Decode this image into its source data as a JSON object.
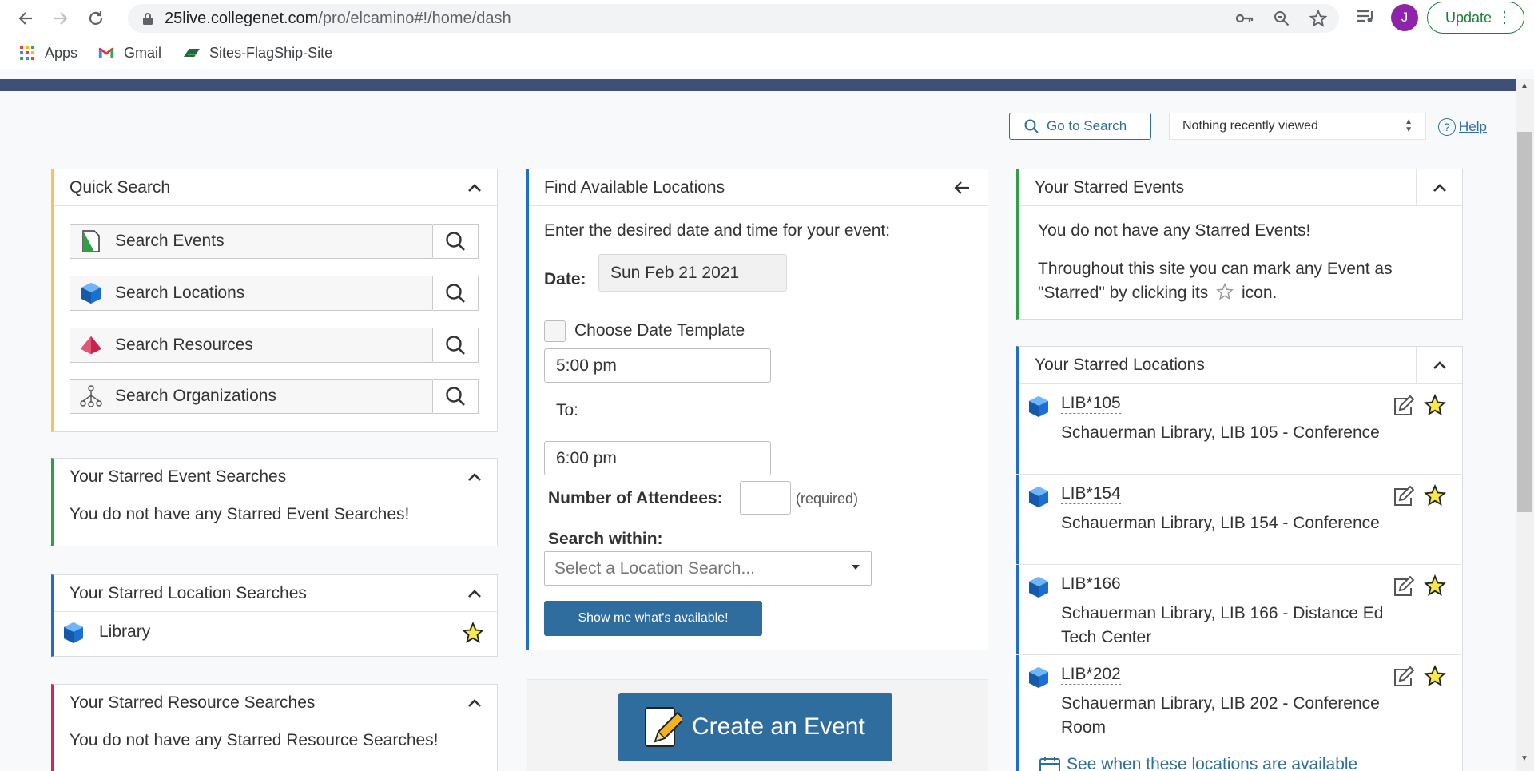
{
  "browser": {
    "url_domain": "25live.collegenet.com",
    "url_path": "/pro/elcamino#!/home/dash",
    "profile_initial": "J",
    "update_label": "Update"
  },
  "bookmarks": [
    {
      "label": "Apps",
      "icon": "apps-grid-icon"
    },
    {
      "label": "Gmail",
      "icon": "gmail-icon"
    },
    {
      "label": "Sites-FlagShip-Site",
      "icon": "flag-icon"
    }
  ],
  "topbar": {
    "go_to_search": "Go to Search",
    "recent": "Nothing recently viewed",
    "help": "Help"
  },
  "quick_search": {
    "title": "Quick Search",
    "items": [
      {
        "label": "Search Events",
        "icon": "event-doc-icon"
      },
      {
        "label": "Search Locations",
        "icon": "location-cube-icon"
      },
      {
        "label": "Search Resources",
        "icon": "resource-pyramid-icon"
      },
      {
        "label": "Search Organizations",
        "icon": "org-tree-icon"
      }
    ]
  },
  "starred_event_searches": {
    "title": "Your Starred Event Searches",
    "empty": "You do not have any Starred Event Searches!"
  },
  "starred_location_searches": {
    "title": "Your Starred Location Searches",
    "item": "Library"
  },
  "starred_resource_searches": {
    "title": "Your Starred Resource Searches",
    "empty": "You do not have any Starred Resource Searches!"
  },
  "find_locations": {
    "title": "Find Available Locations",
    "intro": "Enter the desired date and time for your event:",
    "date_label": "Date:",
    "date_value": "Sun Feb 21 2021",
    "template_label": "Choose Date Template",
    "start_time": "5:00 pm",
    "to_label": "To:",
    "end_time": "6:00 pm",
    "attendees_label": "Number of Attendees:",
    "required_label": "(required)",
    "search_within_label": "Search within:",
    "search_within_placeholder": "Select a Location Search...",
    "submit_label": "Show me what's available!"
  },
  "create_event": {
    "label": "Create an Event"
  },
  "starred_events": {
    "title": "Your Starred Events",
    "empty": "You do not have any Starred Events!",
    "hint_before": "Throughout this site you can mark any Event as \"Starred\" by clicking its",
    "hint_after": "icon."
  },
  "starred_locations": {
    "title": "Your Starred Locations",
    "items": [
      {
        "code": "LIB*105",
        "description": "Schauerman Library, LIB 105 - Conference"
      },
      {
        "code": "LIB*154",
        "description": "Schauerman Library, LIB 154 - Conference"
      },
      {
        "code": "LIB*166",
        "description": "Schauerman Library, LIB 166 - Distance Ed Tech Center"
      },
      {
        "code": "LIB*202",
        "description": "Schauerman Library, LIB 202 - Conference Room"
      }
    ],
    "availability_link": "See when these locations are available"
  },
  "colors": {
    "app_bar": "#3f5077",
    "accent_blue": "#2e6d9e",
    "quick_search_border": "#f4c45a",
    "event_border": "#2f9e44",
    "location_border": "#1f6fc5",
    "resource_border": "#cc2954",
    "star_fill": "#f7e94a"
  }
}
